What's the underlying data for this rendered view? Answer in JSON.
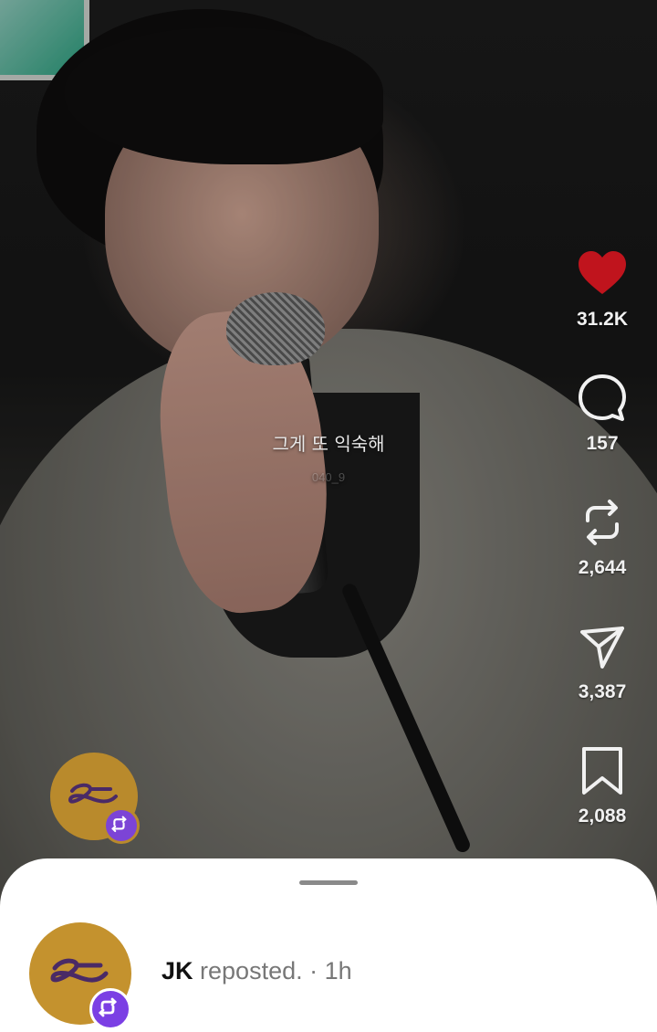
{
  "video": {
    "lyric": "그게 또 익숙해",
    "watermark": "040_9"
  },
  "actions": [
    {
      "icon": "heart-filled-icon",
      "count": "31.2K",
      "color": "#c0141d"
    },
    {
      "icon": "comment-icon",
      "count": "157"
    },
    {
      "icon": "repost-icon",
      "count": "2,644"
    },
    {
      "icon": "share-icon",
      "count": "3,387"
    },
    {
      "icon": "bookmark-icon",
      "count": "2,088"
    }
  ],
  "sheet": {
    "username": "JK",
    "action_text": "reposted.",
    "separator": "·",
    "time": "1h"
  },
  "colors": {
    "avatar_bg": "#c4922e",
    "repost_badge": "#7b3fe4",
    "liked": "#c0141d"
  }
}
